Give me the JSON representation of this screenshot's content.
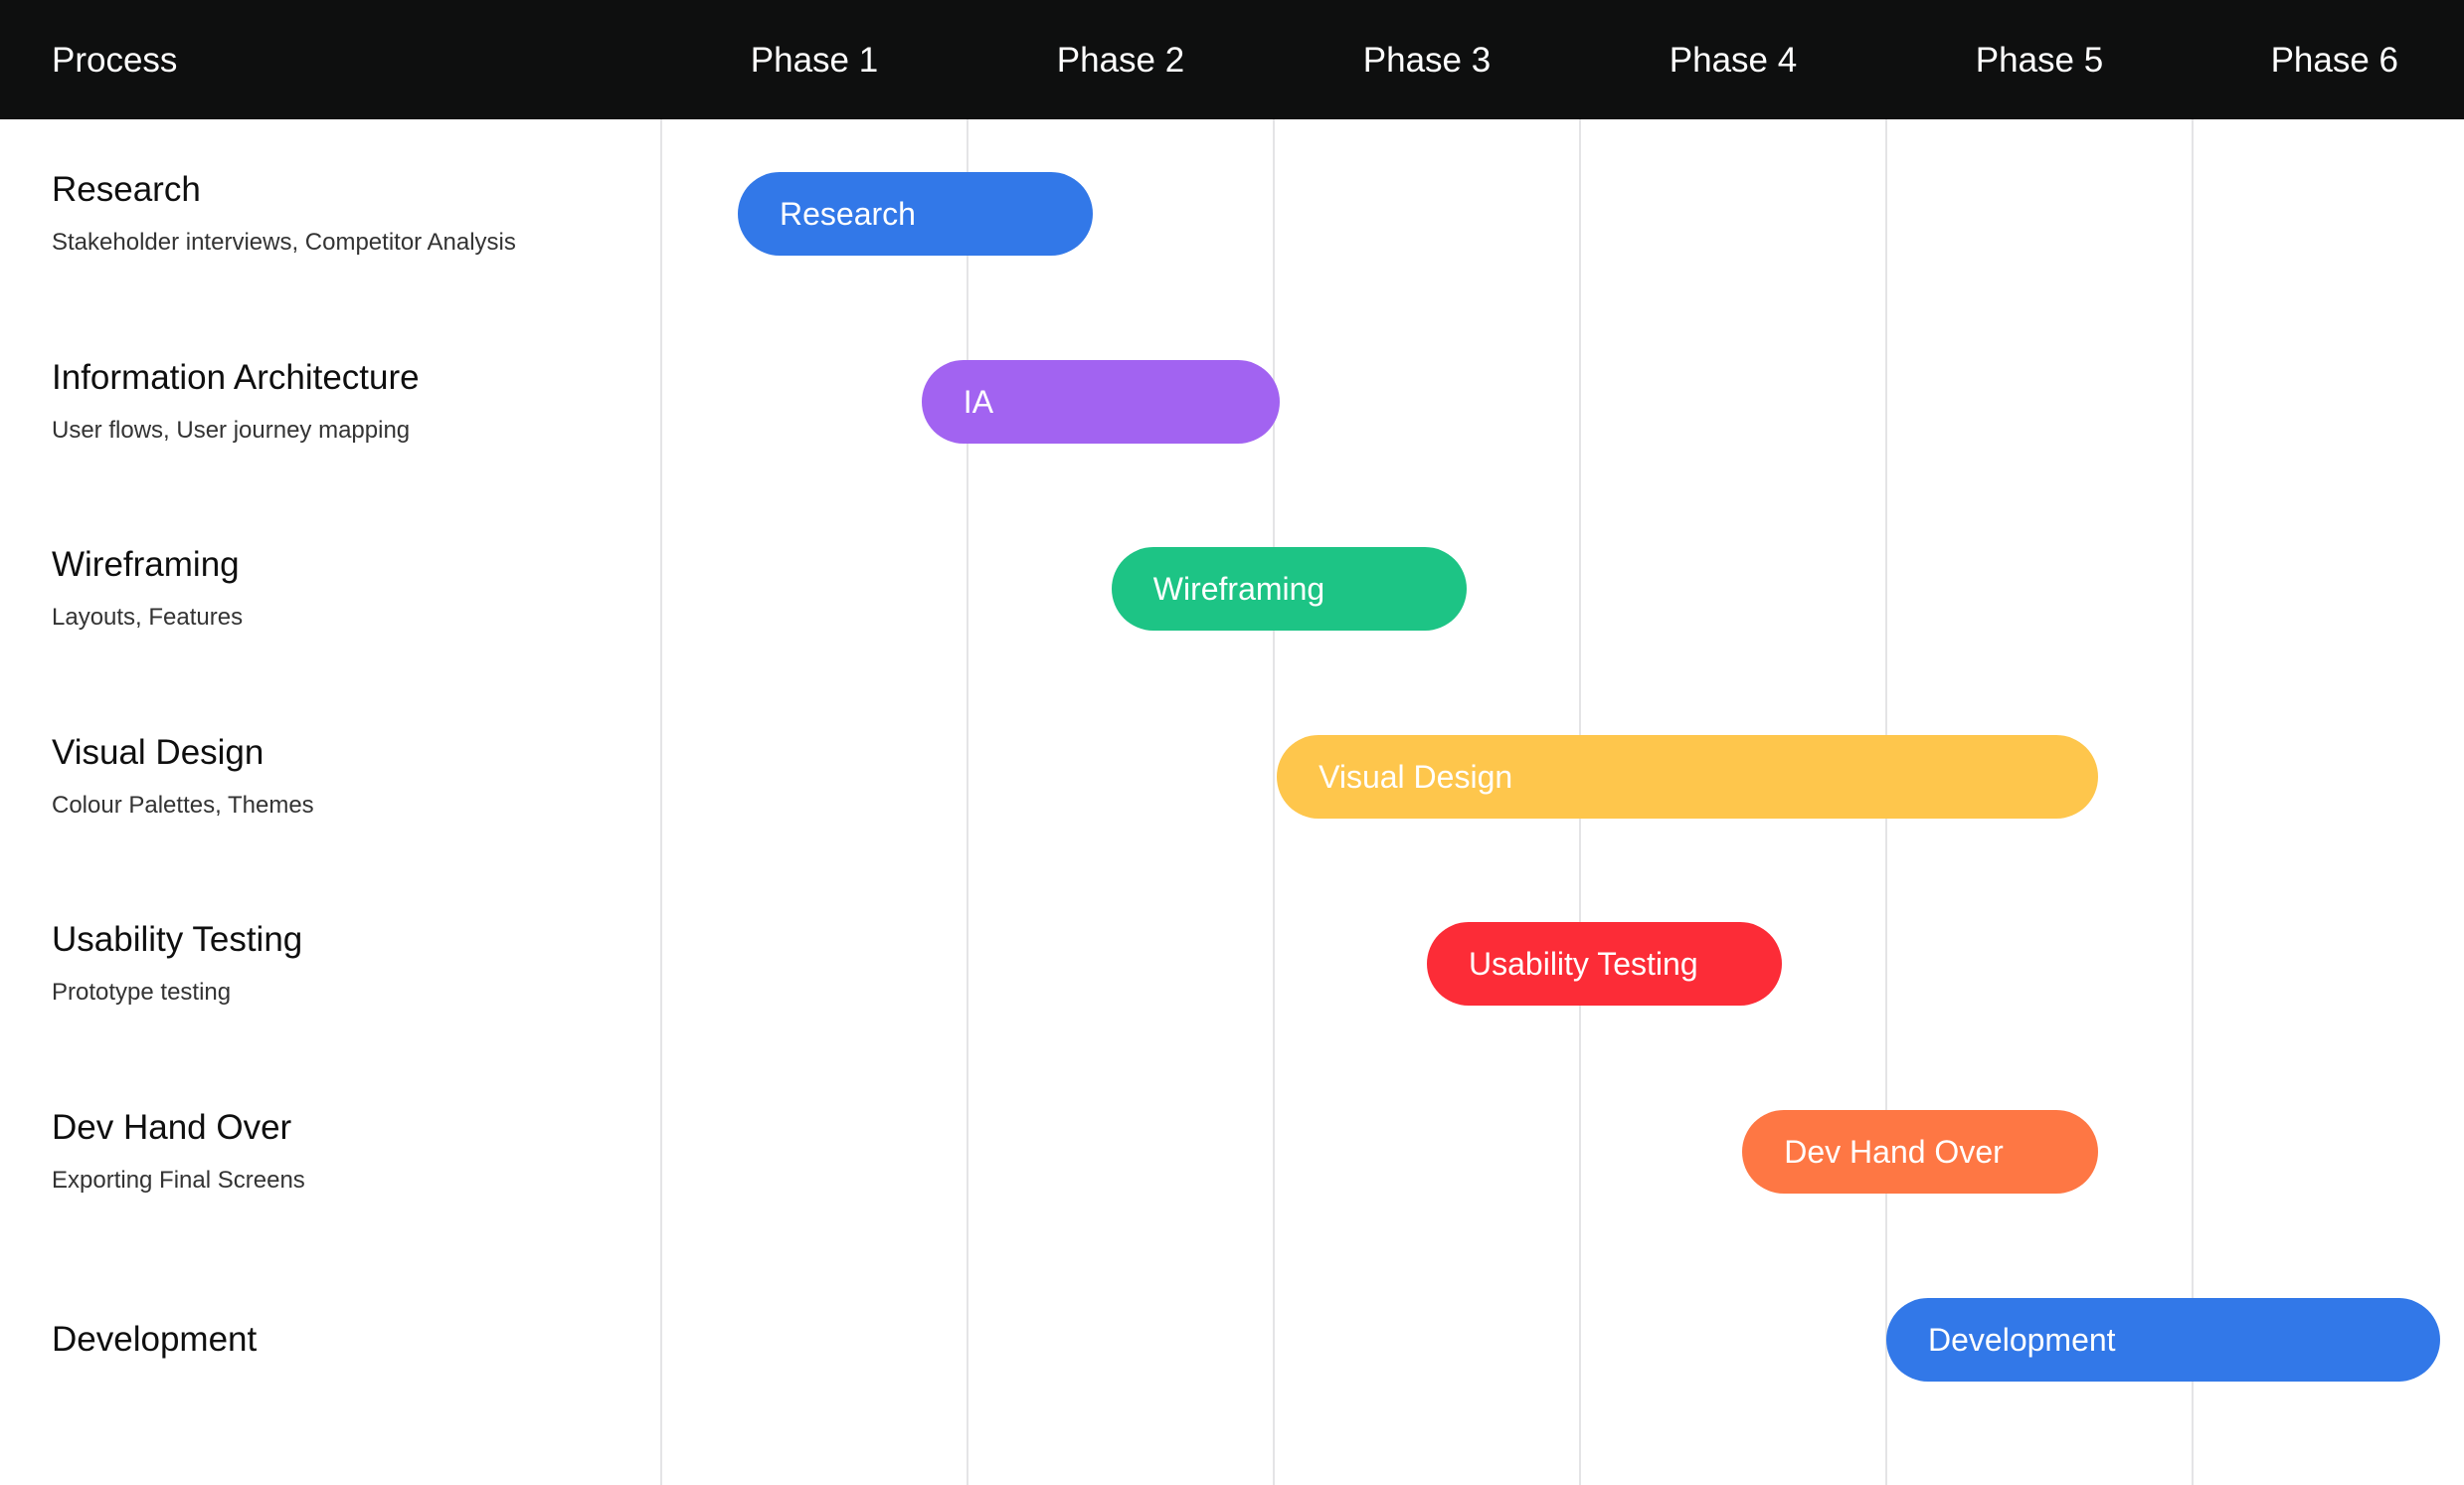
{
  "header": {
    "process_label": "Process",
    "phases": [
      "Phase 1",
      "Phase 2",
      "Phase 3",
      "Phase 4",
      "Phase 5",
      "Phase 6"
    ]
  },
  "rows": [
    {
      "title": "Research",
      "subtitle": "Stakeholder interviews, Competitor Analysis",
      "bar_label": "Research",
      "color": "#3278e8",
      "start": 1.25,
      "end": 2.41
    },
    {
      "title": "Information Architecture",
      "subtitle": "User flows, User journey mapping",
      "bar_label": "IA",
      "color": "#a263f1",
      "start": 1.85,
      "end": 3.02
    },
    {
      "title": "Wireframing",
      "subtitle": "Layouts, Features",
      "bar_label": "Wireframing",
      "color": "#1dc485",
      "start": 2.47,
      "end": 3.63
    },
    {
      "title": "Visual Design",
      "subtitle": "Colour Palettes, Themes",
      "bar_label": "Visual Design",
      "color": "#fec64c",
      "start": 3.01,
      "end": 5.69
    },
    {
      "title": "Usability Testing",
      "subtitle": "Prototype testing",
      "bar_label": "Usability Testing",
      "color": "#fc2c37",
      "start": 3.5,
      "end": 4.66
    },
    {
      "title": "Dev Hand Over",
      "subtitle": "Exporting Final Screens",
      "bar_label": "Dev Hand Over",
      "color": "#fe7744",
      "start": 4.53,
      "end": 5.69
    },
    {
      "title": "Development",
      "subtitle": "",
      "bar_label": "Development",
      "color": "#3278e8",
      "start": 5.0,
      "end": 6.81
    }
  ]
}
